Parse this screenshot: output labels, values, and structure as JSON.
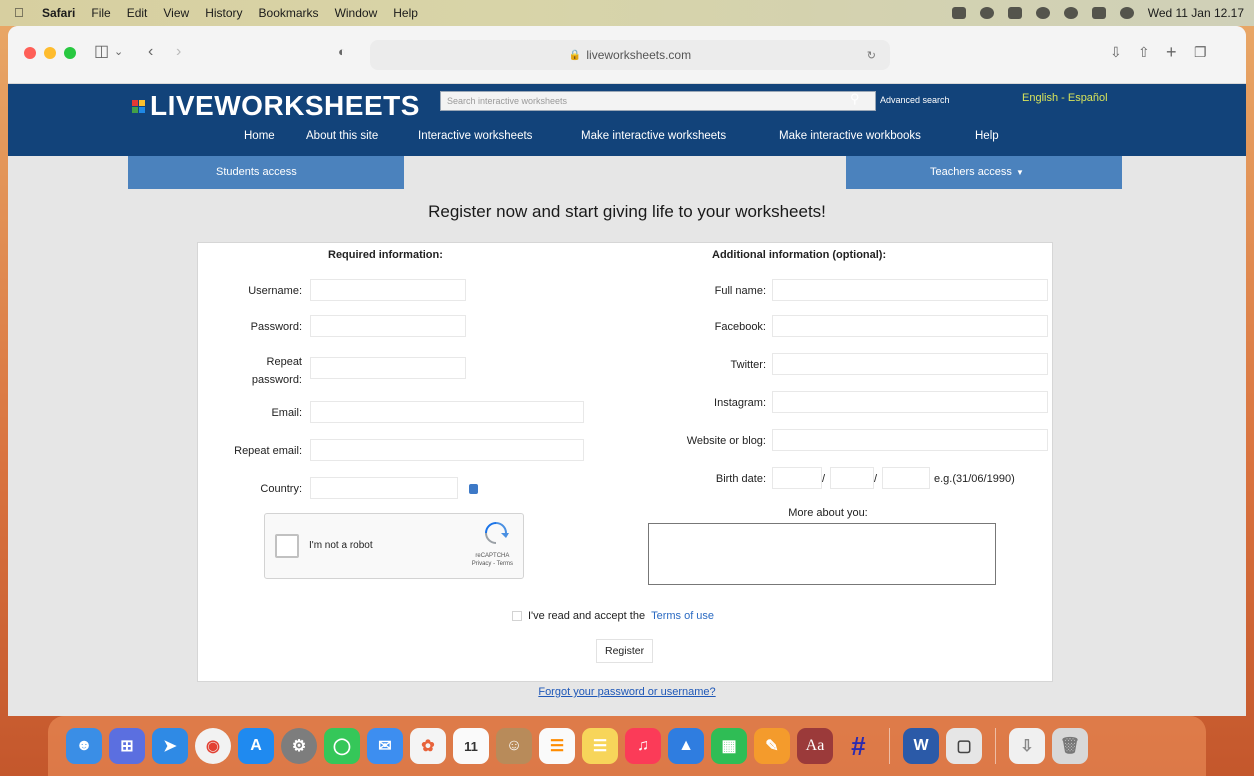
{
  "menubar": {
    "items": [
      "Safari",
      "File",
      "Edit",
      "View",
      "History",
      "Bookmarks",
      "Window",
      "Help"
    ],
    "datetime": "Wed 11 Jan  12.17"
  },
  "browser": {
    "url": "liveworksheets.com"
  },
  "site": {
    "logo": "LIVEWORKSHEETS",
    "search_placeholder": "Search interactive worksheets",
    "advanced_search": "Advanced search",
    "language": "English - Español",
    "nav": [
      "Home",
      "About this site",
      "Interactive worksheets",
      "Make interactive worksheets",
      "Make interactive workbooks",
      "Help"
    ],
    "students_access": "Students access",
    "teachers_access": "Teachers access"
  },
  "form": {
    "title": "Register now and start giving life to your worksheets!",
    "required_title": "Required information:",
    "optional_title": "Additional information (optional):",
    "required_fields": [
      "Username:",
      "Password:",
      "Repeat password:",
      "Email:",
      "Repeat email:",
      "Country:"
    ],
    "optional_fields": [
      "Full name:",
      "Facebook:",
      "Twitter:",
      "Instagram:",
      "Website or blog:",
      "Birth date:"
    ],
    "birth_date_sep": "/",
    "birth_date_hint": "e.g.(31/06/1990)",
    "more_about": "More about you:",
    "captcha_label": "I'm not a robot",
    "captcha_brand": "reCAPTCHA",
    "captcha_links": "Privacy - Terms",
    "terms_prefix": "I've read and accept the",
    "terms_link": "Terms of use",
    "register_button": "Register",
    "forgot_link": "Forgot your password or username?"
  },
  "colors": {
    "header_bg": "#12437a",
    "access_tab": "#4b82bd",
    "lang_link": "#d8e45a",
    "link": "#2a6ac2"
  },
  "dock_apps": [
    "finder-icon",
    "launchpad-icon",
    "safari-icon",
    "chrome-icon",
    "app-store-icon",
    "system-preferences-icon",
    "messages-icon",
    "mail-icon",
    "photos-icon",
    "calendar-icon",
    "contacts-icon",
    "reminders-icon",
    "notes-icon",
    "music-icon",
    "keynote-icon",
    "numbers-icon",
    "pages-icon",
    "dictionary-icon",
    "hashtag-app-icon",
    "word-icon",
    "preview-icon",
    "downloads-icon",
    "trash-icon"
  ],
  "dock_calendar_day": "11",
  "dock_dictionary_label": "Aa"
}
